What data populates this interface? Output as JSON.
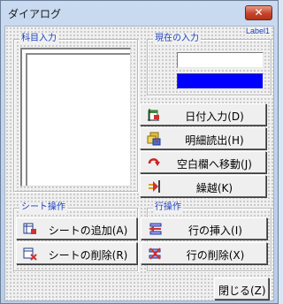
{
  "window": {
    "title": "ダイアログ",
    "close_glyph": "✕"
  },
  "label1": "Label1",
  "subject_group": {
    "title": "科目入力"
  },
  "current_group": {
    "title": "現在の入力"
  },
  "sheet_group": {
    "title": "シート操作",
    "add_label": "シートの追加(A)",
    "delete_label": "シートの削除(R)"
  },
  "row_group": {
    "title": "行操作",
    "insert_label": "行の挿入(I)",
    "delete_label": "行の削除(X)"
  },
  "buttons": {
    "date_input": "日付入力(D)",
    "detail_read": "明細読出(H)",
    "move_blank": "空白欄へ移動(J)",
    "carry_over": "繰越(K)",
    "close": "閉じる(Z)"
  },
  "colors": {
    "color_box": "#0000ff",
    "group_title": "#1a3fbf"
  },
  "icons": [
    "calendar-icon",
    "cards-icon",
    "arrow-return-icon",
    "carry-over-icon",
    "add-sheet-icon",
    "delete-sheet-icon",
    "insert-row-icon",
    "delete-row-icon"
  ]
}
